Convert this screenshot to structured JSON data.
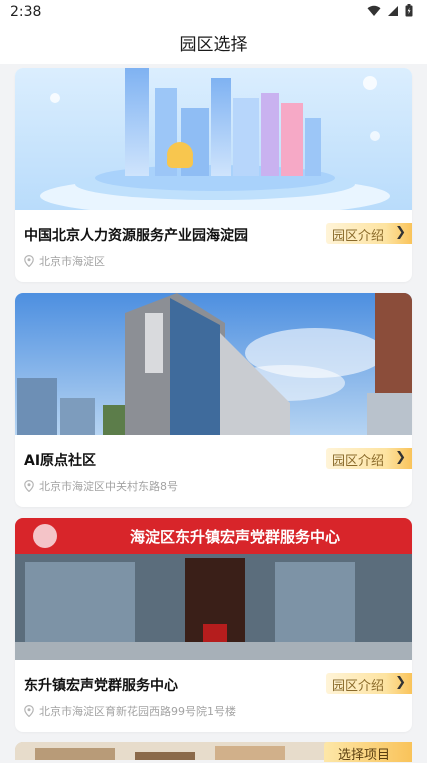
{
  "status_bar": {
    "time": "2:38"
  },
  "header": {
    "title": "园区选择"
  },
  "parks": [
    {
      "name": "中国北京人力资源服务产业园海淀园",
      "address": "北京市海淀区",
      "intro_label": "园区介绍"
    },
    {
      "name": "AI原点社区",
      "address": "北京市海淀区中关村东路8号",
      "intro_label": "园区介绍"
    },
    {
      "name": "东升镇宏声党群服务中心",
      "address": "北京市海淀区育新花园西路99号院1号楼",
      "intro_label": "园区介绍",
      "sign_text": "海淀区东升镇宏声党群服务中心"
    }
  ],
  "bottom_action": {
    "label": "选择项目"
  },
  "colors": {
    "accent": "#f9c35a",
    "background": "#f2f3f5"
  }
}
